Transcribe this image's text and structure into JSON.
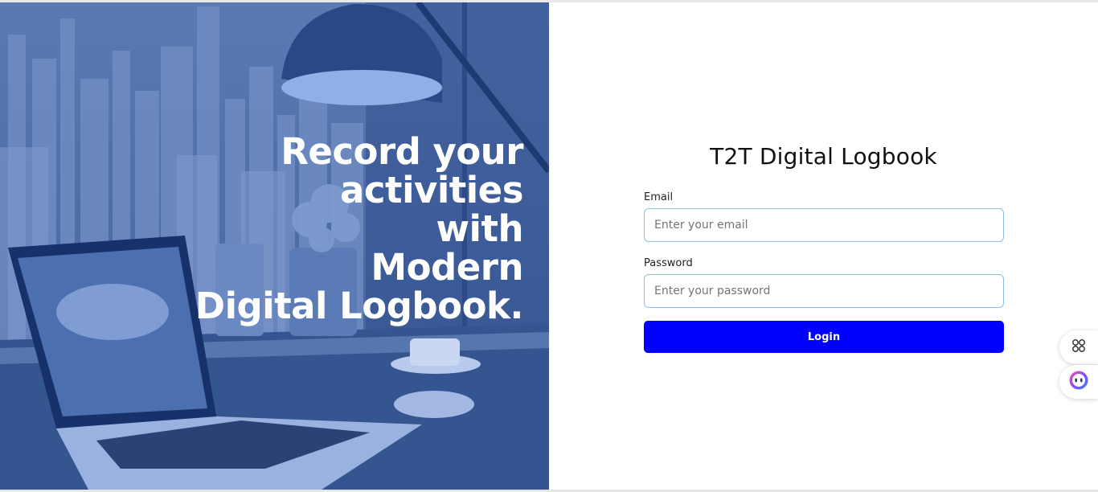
{
  "hero": {
    "headline_lines": [
      "Record your",
      "activities",
      "with",
      "Modern",
      "Digital Logbook."
    ]
  },
  "login": {
    "title": "T2T Digital Logbook",
    "email_label": "Email",
    "email_placeholder": "Enter your email",
    "email_value": "",
    "password_label": "Password",
    "password_placeholder": "Enter your password",
    "password_value": "",
    "button_label": "Login"
  },
  "widgets": [
    {
      "icon": "apps-grid-icon"
    },
    {
      "icon": "assistant-bot-icon"
    }
  ],
  "colors": {
    "hero_tint": "#4f6ea8",
    "primary_button": "#0000ff",
    "input_border": "#8fbfe6",
    "text_dark": "#111111"
  }
}
